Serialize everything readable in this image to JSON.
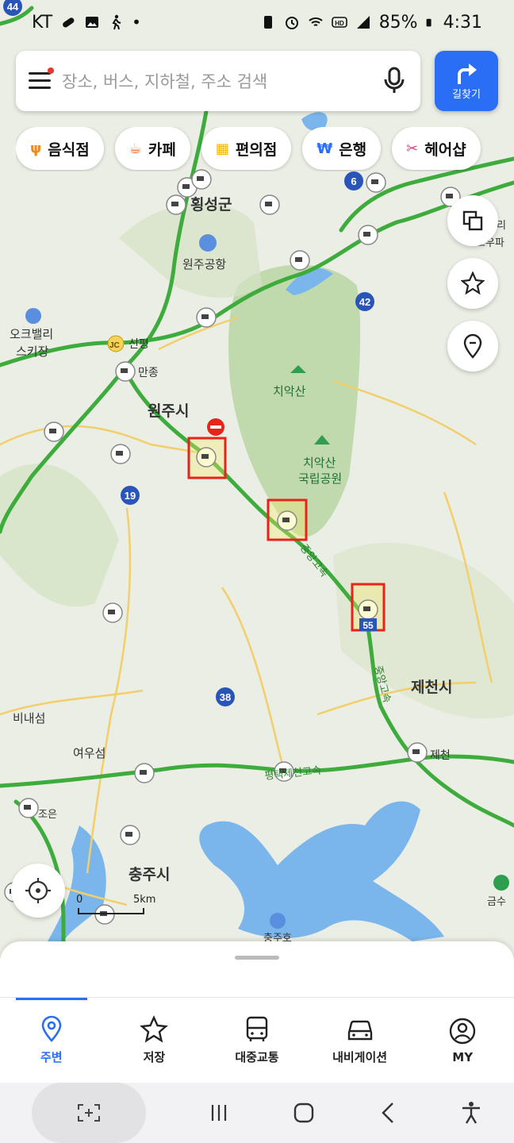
{
  "status_bar": {
    "carrier": "KT",
    "battery": "85%",
    "time": "4:31"
  },
  "search": {
    "placeholder": "장소, 버스, 지하철, 주소 검색"
  },
  "route_button": {
    "label": "길찾기"
  },
  "categories": [
    {
      "label": "음식점",
      "icon": "fork-knife-icon",
      "color": "#f08a1c"
    },
    {
      "label": "카페",
      "icon": "coffee-cup-icon",
      "color": "#f06a2a"
    },
    {
      "label": "편의점",
      "icon": "store-icon",
      "color": "#f5b400"
    },
    {
      "label": "은행",
      "icon": "won-icon",
      "color": "#2a6ef5"
    },
    {
      "label": "헤어샵",
      "icon": "scissors-icon",
      "color": "#e03b8f"
    }
  ],
  "map_labels": {
    "hoengseong": "횡성군",
    "wonju_airport": "원주공항",
    "oak_valley": "오크밸리",
    "ski": "스키장",
    "sinpyeong": "신평",
    "jc": "JC",
    "manjong": "만종",
    "wonju": "원주시",
    "chiaksan": "치악산",
    "chiaksan_park_1": "치악산",
    "chiaksan_park_2": "국립공원",
    "jungang_1": "중앙고속",
    "jungang_2": "중앙고속",
    "jecheon_city": "제천시",
    "jecheon": "제천",
    "binaeseom": "비내섬",
    "yeoueseom": "여우섬",
    "pyeongtaek": "평택제천고속",
    "chungju": "충주시",
    "to_eun": "조은",
    "geumsu": "금수",
    "chungju_dam": "충주호",
    "frag1": "프리",
    "frag2": "고우파",
    "scale_zero": "0",
    "scale_5km": "5km"
  },
  "route_shields": {
    "r6": "6",
    "r19": "19",
    "r38": "38",
    "r42": "42",
    "r44": "44",
    "r55": "55"
  },
  "bottom_nav": [
    {
      "label": "주변",
      "icon": "nearby-pin-icon",
      "active": true
    },
    {
      "label": "저장",
      "icon": "star-icon",
      "active": false
    },
    {
      "label": "대중교통",
      "icon": "bus-icon",
      "active": false
    },
    {
      "label": "내비게이션",
      "icon": "car-icon",
      "active": false
    },
    {
      "label": "MY",
      "icon": "profile-icon",
      "active": false
    }
  ],
  "colors": {
    "accent": "#2a6ef5",
    "highway": "#3dac3d",
    "highlight_box": "#e8241a",
    "water": "#7ab6ec",
    "forest": "#c9dcb4"
  }
}
